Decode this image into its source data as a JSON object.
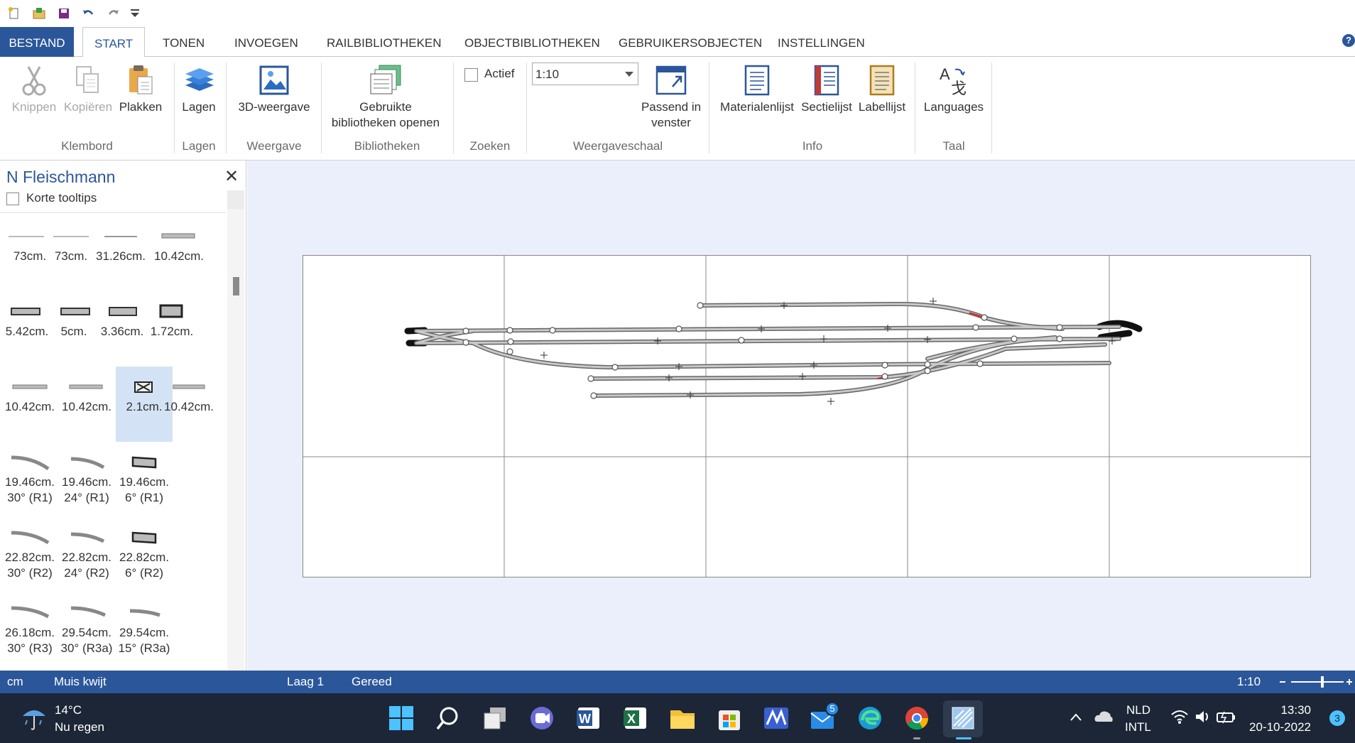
{
  "ribbon": {
    "tabs": [
      {
        "label": "BESTAND"
      },
      {
        "label": "START"
      },
      {
        "label": "TONEN"
      },
      {
        "label": "INVOEGEN"
      },
      {
        "label": "RAILBIBLIOTHEKEN"
      },
      {
        "label": "OBJECTBIBLIOTHEKEN"
      },
      {
        "label": "GEBRUIKERSOBJECTEN"
      },
      {
        "label": "INSTELLINGEN"
      }
    ],
    "help": "?",
    "buttons": {
      "cut": "Knippen",
      "copy": "Kopiëren",
      "paste": "Plakken",
      "layers": "Lagen",
      "view3d": "3D-weergave",
      "used_libs_line1": "Gebruikte",
      "used_libs_line2": "bibliotheken openen",
      "active": "Actief",
      "scale_value": "1:10",
      "fit_line1": "Passend in",
      "fit_line2": "venster",
      "materials": "Materialenlijst",
      "sections": "Sectielijst",
      "labels": "Labellijst",
      "languages": "Languages"
    },
    "groups": {
      "clipboard": "Klembord",
      "layers": "Lagen",
      "view": "Weergave",
      "libraries": "Bibliotheken",
      "search": "Zoeken",
      "scale": "Weergaveschaal",
      "info": "Info",
      "language": "Taal"
    }
  },
  "panel": {
    "title": "N Fleischmann",
    "short_tooltips": "Korte tooltips",
    "pieces": [
      {
        "l1": "73cm.",
        "l2": ""
      },
      {
        "l1": "73cm.",
        "l2": ""
      },
      {
        "l1": "31.26cm.",
        "l2": ""
      },
      {
        "l1": "10.42cm.",
        "l2": ""
      },
      {
        "l1": "5.42cm.",
        "l2": ""
      },
      {
        "l1": "5cm.",
        "l2": ""
      },
      {
        "l1": "3.36cm.",
        "l2": ""
      },
      {
        "l1": "1.72cm.",
        "l2": ""
      },
      {
        "l1": "10.42cm.",
        "l2": ""
      },
      {
        "l1": "10.42cm.",
        "l2": ""
      },
      {
        "l1": "2.1cm.",
        "l2": ""
      },
      {
        "l1": "10.42cm.",
        "l2": ""
      },
      {
        "l1": "19.46cm.",
        "l2": "30° (R1)"
      },
      {
        "l1": "19.46cm.",
        "l2": "24° (R1)"
      },
      {
        "l1": "19.46cm.",
        "l2": "6° (R1)"
      },
      {
        "l1": "22.82cm.",
        "l2": "30° (R2)"
      },
      {
        "l1": "22.82cm.",
        "l2": "24° (R2)"
      },
      {
        "l1": "22.82cm.",
        "l2": "6° (R2)"
      },
      {
        "l1": "26.18cm.",
        "l2": "30° (R3)"
      },
      {
        "l1": "29.54cm.",
        "l2": "30° (R3a)"
      },
      {
        "l1": "29.54cm.",
        "l2": "15° (R3a)"
      }
    ]
  },
  "status": {
    "unit": "cm",
    "mouse": "Muis kwijt",
    "layer": "Laag 1",
    "state": "Gereed",
    "scale": "1:10"
  },
  "taskbar": {
    "temp": "14°C",
    "weather": "Nu regen",
    "lang1": "NLD",
    "lang2": "INTL",
    "time": "13:30",
    "date": "20-10-2022",
    "mail_badge": "5",
    "notif_badge": "3"
  }
}
